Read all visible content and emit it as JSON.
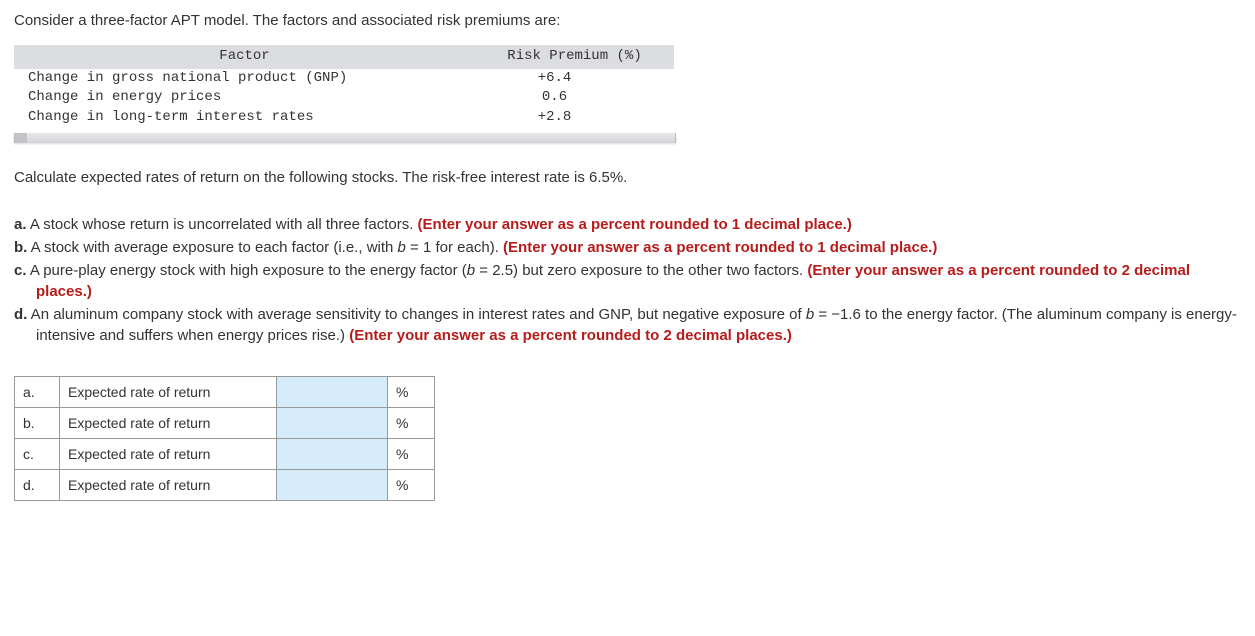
{
  "intro": "Consider a three-factor APT model. The factors and associated risk premiums are:",
  "factor_table": {
    "headers": {
      "factor": "Factor",
      "premium": "Risk Premium (%)"
    },
    "rows": [
      {
        "factor": "Change in gross national product (GNP)",
        "premium": "+6.4"
      },
      {
        "factor": "Change in energy prices",
        "premium": "0.6"
      },
      {
        "factor": "Change in long-term interest rates",
        "premium": "+2.8"
      }
    ]
  },
  "calc_line": "Calculate expected rates of return on the following stocks. The risk-free interest rate is 6.5%.",
  "questions": {
    "a": {
      "letter": "a.",
      "text": " A stock whose return is uncorrelated with all three factors. ",
      "hint": "(Enter your answer as a percent rounded to 1 decimal place.)"
    },
    "b": {
      "letter": "b.",
      "text_pre": " A stock with average exposure to each factor (i.e., with ",
      "var": "b",
      "text_mid": " = 1 for each). ",
      "hint": "(Enter your answer as a percent rounded to 1 decimal place.)"
    },
    "c": {
      "letter": "c.",
      "text_pre": " A pure-play energy stock with high exposure to the energy factor (",
      "var": "b",
      "text_mid": " = 2.5) but zero exposure to the other two factors. ",
      "hint": "(Enter your answer as a percent rounded to 2 decimal places.)"
    },
    "d": {
      "letter": "d.",
      "text_pre": " An aluminum company stock with average sensitivity to changes in interest rates and GNP, but negative exposure of ",
      "var": "b",
      "text_mid": " = −1.6 to the energy factor. (The aluminum company is energy-intensive and suffers when energy prices rise.) ",
      "hint": "(Enter your answer as a percent rounded to 2 decimal places.)"
    }
  },
  "answer_table": {
    "rows": [
      {
        "letter": "a.",
        "label": "Expected rate of return",
        "unit": "%"
      },
      {
        "letter": "b.",
        "label": "Expected rate of return",
        "unit": "%"
      },
      {
        "letter": "c.",
        "label": "Expected rate of return",
        "unit": "%"
      },
      {
        "letter": "d.",
        "label": "Expected rate of return",
        "unit": "%"
      }
    ]
  }
}
